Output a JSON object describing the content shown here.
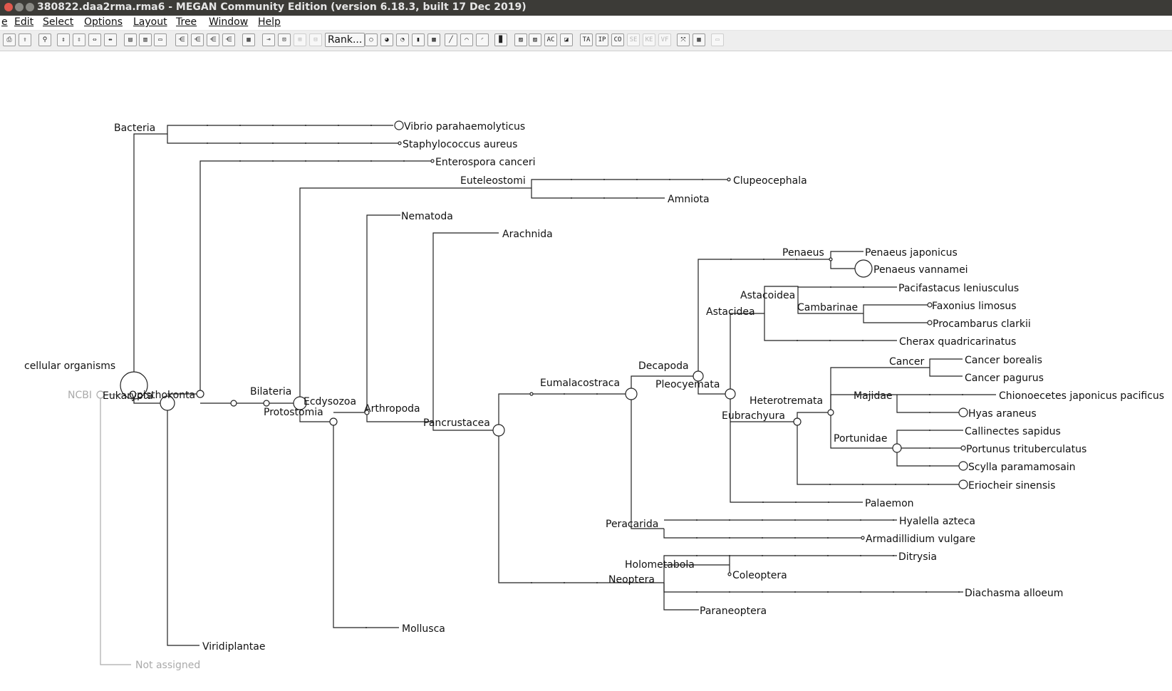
{
  "window": {
    "title": "380822.daa2rma.rma6 - MEGAN Community Edition (version 6.18.3, built 17 Dec 2019)"
  },
  "menubar": [
    {
      "id": "file",
      "label": "e"
    },
    {
      "id": "edit",
      "label": "Edit"
    },
    {
      "id": "select",
      "label": "Select"
    },
    {
      "id": "options",
      "label": "Options"
    },
    {
      "id": "layout",
      "label": "Layout"
    },
    {
      "id": "tree",
      "label": "Tree"
    },
    {
      "id": "window",
      "label": "Window"
    },
    {
      "id": "help",
      "label": "Help"
    }
  ],
  "toolbar": {
    "rank_label": "Rank...",
    "buttons": [
      {
        "name": "print-icon",
        "glyph": "⎙"
      },
      {
        "name": "export-icon",
        "glyph": "⇪"
      },
      {
        "name": "find-icon",
        "glyph": "⚲"
      },
      {
        "name": "expand-vertical-icon",
        "glyph": "⇕"
      },
      {
        "name": "contract-vertical-icon",
        "glyph": "⇳"
      },
      {
        "name": "expand-horizontal-icon",
        "glyph": "⇔"
      },
      {
        "name": "contract-horizontal-icon",
        "glyph": "⇹"
      },
      {
        "name": "fit-window-icon",
        "glyph": "▤"
      },
      {
        "name": "fully-contract-icon",
        "glyph": "▥"
      },
      {
        "name": "fully-expand-icon",
        "glyph": "▭"
      },
      {
        "name": "collapse-icon",
        "glyph": "⋲"
      },
      {
        "name": "uncollapse-icon",
        "glyph": "⋲"
      },
      {
        "name": "uncollapse-subtree-icon",
        "glyph": "⋲"
      },
      {
        "name": "collapse-at-level-icon",
        "glyph": "⋲"
      },
      {
        "name": "color-samples-icon",
        "glyph": "▦"
      },
      {
        "name": "node-labels-icon",
        "glyph": "⊸"
      },
      {
        "name": "node-names-icon",
        "glyph": "⊡"
      },
      {
        "name": "show-counts-icon",
        "glyph": "⊞"
      },
      {
        "name": "show-summary-icon",
        "glyph": "⊟"
      },
      {
        "name": "circle-nodes-icon",
        "glyph": "○"
      },
      {
        "name": "pie-chart-icon",
        "glyph": "◕"
      },
      {
        "name": "coxcomb-icon",
        "glyph": "◔"
      },
      {
        "name": "bars-icon",
        "glyph": "▮"
      },
      {
        "name": "heatmap-icon",
        "glyph": "▩"
      },
      {
        "name": "rectangular-tree-icon",
        "glyph": "╱"
      },
      {
        "name": "slanted-tree-icon",
        "glyph": "⌒"
      },
      {
        "name": "radial-tree-icon",
        "glyph": "◜"
      },
      {
        "name": "chart-icon",
        "glyph": "▉"
      },
      {
        "name": "taxonomy-table-icon",
        "glyph": "▨"
      },
      {
        "name": "samples-table-icon",
        "glyph": "▨"
      },
      {
        "name": "word-cloud-icon",
        "glyph": "AC"
      },
      {
        "name": "color-edit-icon",
        "glyph": "◪"
      },
      {
        "name": "taxonomy-viewer-icon",
        "glyph": "TA"
      },
      {
        "name": "interpro-viewer-icon",
        "glyph": "IP"
      },
      {
        "name": "cog-viewer-icon",
        "glyph": "CO"
      },
      {
        "name": "seed-viewer-icon",
        "glyph": "SE"
      },
      {
        "name": "kegg-viewer-icon",
        "glyph": "KE"
      },
      {
        "name": "eggnog-viewer-icon",
        "glyph": "VF"
      },
      {
        "name": "expand-window-icon",
        "glyph": "⤧"
      },
      {
        "name": "table-icon",
        "glyph": "▦"
      },
      {
        "name": "properties-icon",
        "glyph": "▭"
      }
    ]
  },
  "colors": {
    "edge": "#222222",
    "grey_edge": "#aaaaaa"
  },
  "tree": {
    "root_label": "NCBI",
    "not_assigned_label": "Not assigned",
    "nodes": [
      {
        "id": "cellular",
        "label": "cellular organisms"
      },
      {
        "id": "bacteria",
        "label": "Bacteria"
      },
      {
        "id": "vibrio",
        "label": "Vibrio parahaemolyticus"
      },
      {
        "id": "staph",
        "label": "Staphylococcus aureus"
      },
      {
        "id": "eukaryota",
        "label": "Eukaryota"
      },
      {
        "id": "opisthokonta",
        "label": "Opisthokonta"
      },
      {
        "id": "viridiplantae",
        "label": "Viridiplantae"
      },
      {
        "id": "enterospora",
        "label": "Enterospora canceri"
      },
      {
        "id": "bilateria",
        "label": "Bilateria"
      },
      {
        "id": "protostomia",
        "label": "Protostomia"
      },
      {
        "id": "ecdysozoa",
        "label": "Ecdysozoa"
      },
      {
        "id": "mollusca",
        "label": "Mollusca"
      },
      {
        "id": "euteleostomi",
        "label": "Euteleostomi"
      },
      {
        "id": "clupeocephala",
        "label": "Clupeocephala"
      },
      {
        "id": "amniota",
        "label": "Amniota"
      },
      {
        "id": "nematoda",
        "label": "Nematoda"
      },
      {
        "id": "arthropoda",
        "label": "Arthropoda"
      },
      {
        "id": "arachnida",
        "label": "Arachnida"
      },
      {
        "id": "pancrustacea",
        "label": "Pancrustacea"
      },
      {
        "id": "eumalacostraca",
        "label": "Eumalacostraca"
      },
      {
        "id": "neoptera",
        "label": "Neoptera"
      },
      {
        "id": "decapoda",
        "label": "Decapoda"
      },
      {
        "id": "peracarida",
        "label": "Peracarida"
      },
      {
        "id": "pleocyemata",
        "label": "Pleocyemata"
      },
      {
        "id": "penaeus",
        "label": "Penaeus"
      },
      {
        "id": "penaeus_japonicus",
        "label": "Penaeus japonicus"
      },
      {
        "id": "penaeus_vannamei",
        "label": "Penaeus vannamei"
      },
      {
        "id": "astacidea",
        "label": "Astacidea"
      },
      {
        "id": "astacoidea",
        "label": "Astacoidea"
      },
      {
        "id": "pacifastacus",
        "label": "Pacifastacus leniusculus"
      },
      {
        "id": "cambarinae",
        "label": "Cambarinae"
      },
      {
        "id": "faxonius",
        "label": "Faxonius limosus"
      },
      {
        "id": "procambarus",
        "label": "Procambarus clarkii"
      },
      {
        "id": "cherax",
        "label": "Cherax quadricarinatus"
      },
      {
        "id": "eubrachyura",
        "label": "Eubrachyura"
      },
      {
        "id": "heterotremata",
        "label": "Heterotremata"
      },
      {
        "id": "cancer",
        "label": "Cancer"
      },
      {
        "id": "cancer_borealis",
        "label": "Cancer borealis"
      },
      {
        "id": "cancer_pagurus",
        "label": "Cancer pagurus"
      },
      {
        "id": "majidae",
        "label": "Majidae"
      },
      {
        "id": "chionoecetes",
        "label": "Chionoecetes japonicus pacificus"
      },
      {
        "id": "hyas",
        "label": "Hyas araneus"
      },
      {
        "id": "portunidae",
        "label": "Portunidae"
      },
      {
        "id": "callinectes",
        "label": "Callinectes sapidus"
      },
      {
        "id": "portunus",
        "label": "Portunus trituberculatus"
      },
      {
        "id": "scylla",
        "label": "Scylla paramamosain"
      },
      {
        "id": "eriocheir",
        "label": "Eriocheir sinensis"
      },
      {
        "id": "palaemon",
        "label": "Palaemon"
      },
      {
        "id": "hyalella",
        "label": "Hyalella azteca"
      },
      {
        "id": "armadillidium",
        "label": "Armadillidium vulgare"
      },
      {
        "id": "holometabola",
        "label": "Holometabola"
      },
      {
        "id": "ditrysia",
        "label": "Ditrysia"
      },
      {
        "id": "coleoptera",
        "label": "Coleoptera"
      },
      {
        "id": "diachasma",
        "label": "Diachasma alloeum"
      },
      {
        "id": "paraneoptera",
        "label": "Paraneoptera"
      }
    ]
  }
}
